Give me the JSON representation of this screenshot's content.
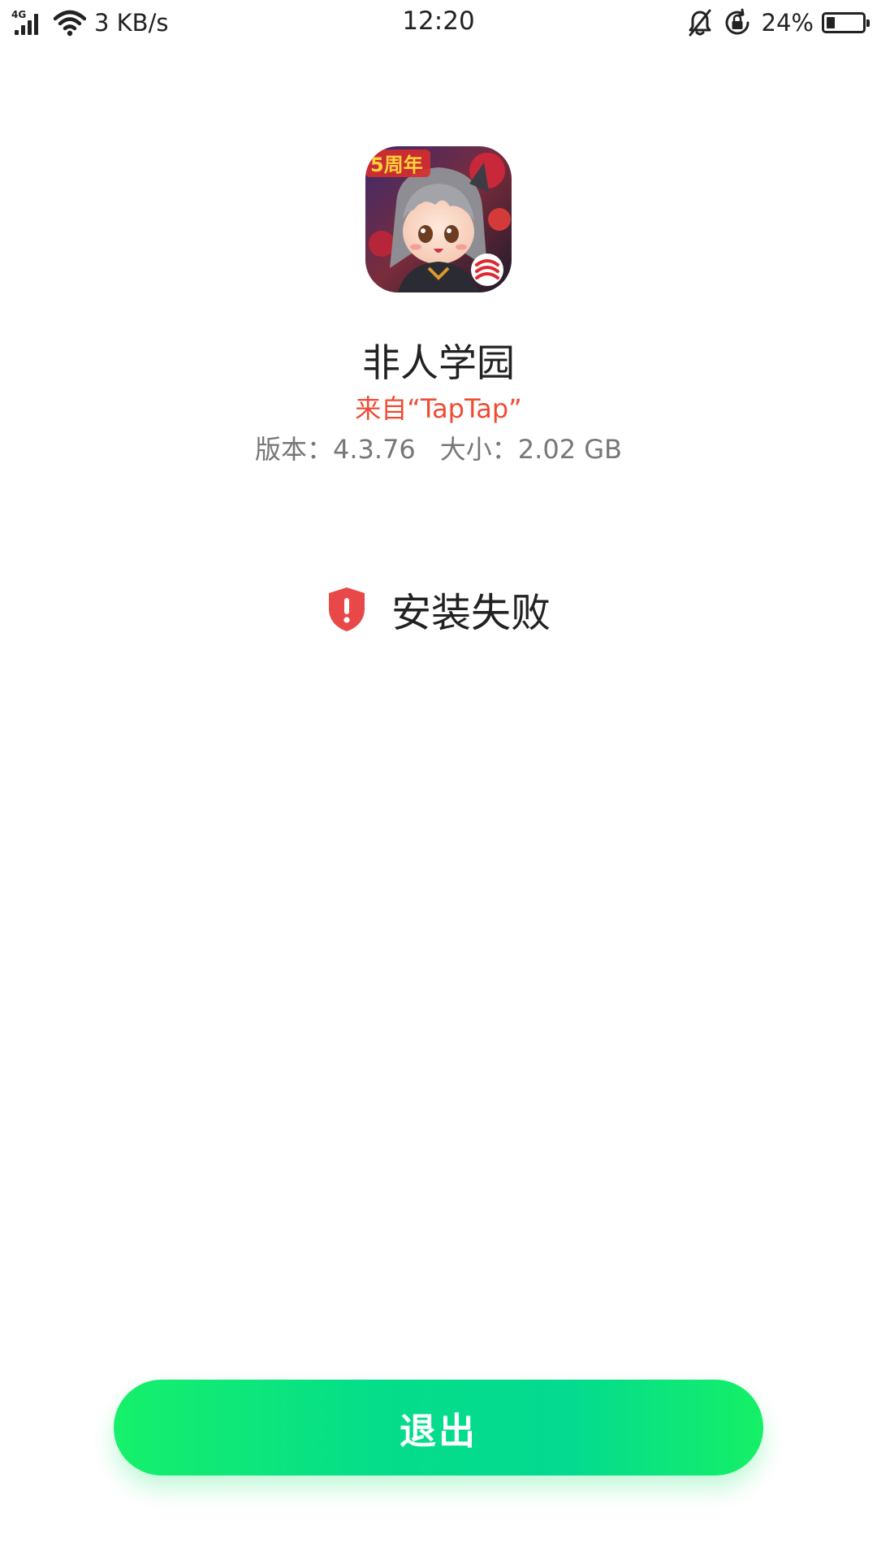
{
  "status_bar": {
    "network_type": "4G",
    "speed": "3 KB/s",
    "time": "12:20",
    "battery_percent_text": "24%",
    "battery_level": 0.24,
    "icons": [
      "signal-icon",
      "wifi-icon",
      "mute-bell-icon",
      "rotation-lock-icon",
      "battery-icon"
    ]
  },
  "app": {
    "name": "非人学园",
    "source": "来自“TapTap”",
    "version_label": "版本：4.3.76",
    "size_label": "大小：2.02 GB",
    "icon_badge": "5周年"
  },
  "result": {
    "text": "安装失败",
    "icon": "shield-warning-icon",
    "icon_color": "#e84848"
  },
  "actions": {
    "exit_label": "退出",
    "button_color": "#05dd8a"
  },
  "colors": {
    "source_text": "#ef4b33",
    "meta_text": "#777777"
  }
}
